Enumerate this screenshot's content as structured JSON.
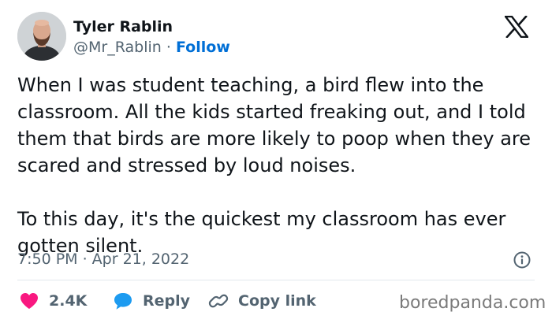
{
  "tweet": {
    "display_name": "Tyler Rablin",
    "handle": "@Mr_Rablin",
    "separator": "·",
    "follow_label": "Follow",
    "text": "When I was student teaching, a bird flew into the classroom. All the kids started freaking out, and I told them that birds are more likely to poop when they are scared and stressed by loud noises.\n\nTo this day, it's the quickest my classroom has ever gotten silent.",
    "timestamp": "7:50 PM · Apr 21, 2022"
  },
  "actions": {
    "like_count": "2.4K",
    "reply_label": "Reply",
    "copy_link_label": "Copy link"
  },
  "icons": {
    "brand": "x-logo-icon",
    "info": "info-icon",
    "like": "heart-icon",
    "reply": "speech-bubble-icon",
    "copy": "link-icon"
  },
  "watermark": "boredpanda.com",
  "colors": {
    "text": "#0f1419",
    "secondary": "#536471",
    "follow": "#006fd6",
    "heart": "#f91880",
    "reply": "#1d9bf0",
    "divider": "#e1e8ed"
  }
}
